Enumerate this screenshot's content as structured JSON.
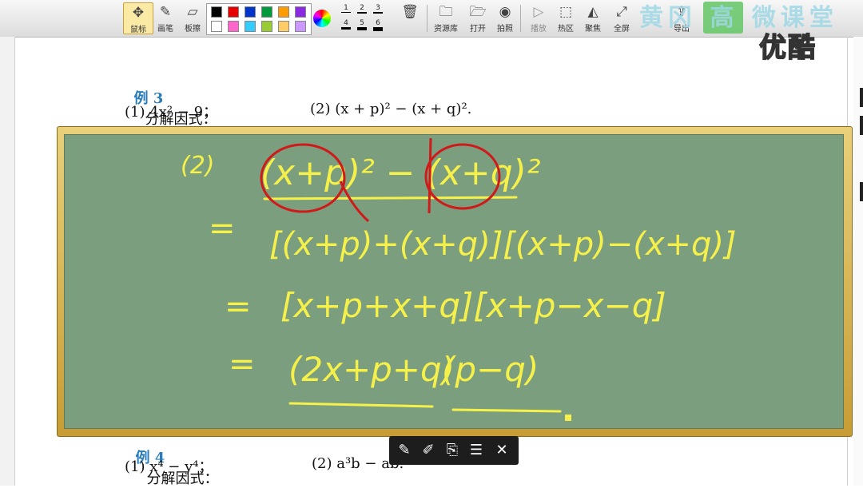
{
  "toolbar": {
    "tools": [
      {
        "label": "鼠标",
        "icon": "cursor-icon",
        "glyph": "✥"
      },
      {
        "label": "画笔",
        "icon": "pen-icon",
        "glyph": "✎"
      },
      {
        "label": "板擦",
        "icon": "eraser-icon",
        "glyph": "▱"
      }
    ],
    "colors": [
      "#000000",
      "#e60000",
      "#0033cc",
      "#009a3c",
      "#ff9a00",
      "#8a2be2",
      "#ffffff",
      "#ff66cc",
      "#33ccff",
      "#99cc33",
      "#ffcc66",
      "#cc99ff"
    ],
    "widths": [
      "1",
      "2",
      "3",
      "4",
      "5",
      "6"
    ],
    "actions": [
      {
        "label": "资源库",
        "icon": "folder-open-icon",
        "glyph": "🗀"
      },
      {
        "label": "打开",
        "icon": "open-file-icon",
        "glyph": "🗁"
      },
      {
        "label": "拍照",
        "icon": "camera-icon",
        "glyph": "◉"
      },
      {
        "label": "播放",
        "icon": "play-icon",
        "glyph": "▷"
      },
      {
        "label": "热区",
        "icon": "hotspot-icon",
        "glyph": "⬚"
      },
      {
        "label": "聚焦",
        "icon": "spotlight-icon",
        "glyph": "◭"
      },
      {
        "label": "全屏",
        "icon": "fullscreen-icon",
        "glyph": "⤢"
      },
      {
        "label": "导出",
        "icon": "export-icon",
        "glyph": "⇪"
      }
    ]
  },
  "watermark": {
    "brand": "黄冈 高 微课堂",
    "youku": "优酷"
  },
  "document": {
    "example3_label": "例 3",
    "example3_title": "分解因式：",
    "example3_q1": "(1) 4x² − 9；",
    "example3_q2": "(2) (x + p)² − (x + q)².",
    "example4_label": "例 4",
    "example4_title": "分解因式：",
    "example4_q1": "(1) x⁴ − y⁴；",
    "example4_q2": "(2) a³b − ab."
  },
  "board_text": {
    "line0_label": "(2)",
    "line0": "(x+p)² − (x+q)²",
    "line1_eq": "=",
    "line1": "[(x+p)+(x+q)][(x+p)−(x+q)]",
    "line2_eq": "=",
    "line2": "[x+p+x+q][x+p−x−q]",
    "line3_eq": "=",
    "line3a": "(2x+p+q)",
    "line3b": "(p−q)"
  },
  "pen_toolbar": [
    {
      "icon": "pen-icon",
      "glyph": "✎"
    },
    {
      "icon": "eraser-icon",
      "glyph": "✐"
    },
    {
      "icon": "new-page-icon",
      "glyph": "⎘"
    },
    {
      "icon": "list-icon",
      "glyph": "☰"
    },
    {
      "icon": "close-icon",
      "glyph": "✕"
    }
  ],
  "colors": {
    "board": "#7a9e7e",
    "chalk": "#f6f04a",
    "circle": "#d01a1a",
    "frame": "#d9b350"
  }
}
